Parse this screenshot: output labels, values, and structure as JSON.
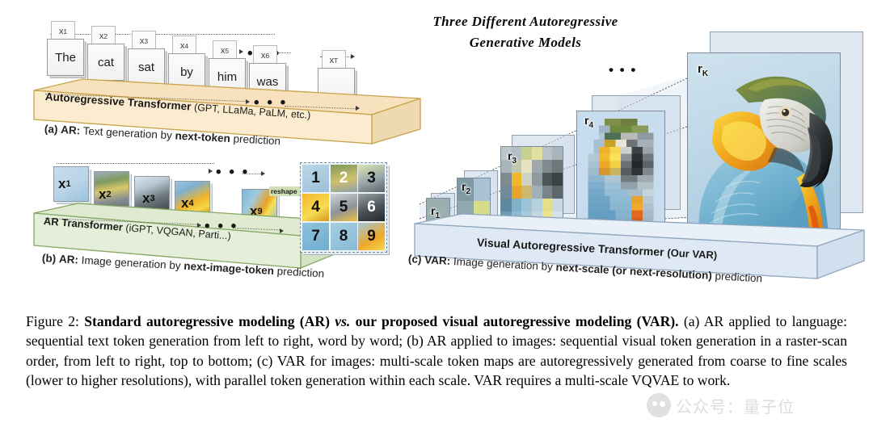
{
  "figure": {
    "heading_line1": "Three  Different  Autoregressive",
    "heading_line2": "Generative  Models",
    "caption_label": "Figure 2:",
    "caption_bold": "Standard autoregressive modeling (AR)",
    "caption_italic": "vs.",
    "caption_bold2": "our proposed visual autoregressive modeling (VAR).",
    "caption_rest": "(a) AR applied to language: sequential text token generation from left to right, word by word; (b) AR applied to images: sequential visual token generation in a raster-scan order, from left to right, top to bottom; (c) VAR for images: multi-scale token maps are autoregressively generated from coarse to fine scales (lower to higher resolutions), with parallel token generation within each scale. VAR requires a multi-scale VQVAE to work."
  },
  "watermark": {
    "text": "公众号：量子位"
  },
  "panel_a": {
    "platform_label_bold": "Autoregressive Transformer",
    "platform_label_rest": "(GPT, LLaMa, PaLM, etc.)",
    "tokens": [
      {
        "tag": "x",
        "sub": "1",
        "word": "The"
      },
      {
        "tag": "x",
        "sub": "2",
        "word": "cat"
      },
      {
        "tag": "x",
        "sub": "3",
        "word": "sat"
      },
      {
        "tag": "x",
        "sub": "4",
        "word": "by"
      },
      {
        "tag": "x",
        "sub": "5",
        "word": "him"
      },
      {
        "tag": "x",
        "sub": "6",
        "word": "was"
      },
      {
        "tag": "x",
        "sub": "T",
        "word": "."
      }
    ],
    "ellipsis": "• • •",
    "caption_prefix": "(a)",
    "caption_kind": "AR:",
    "caption_text_1": "Text generation by",
    "caption_bold": "next-token",
    "caption_text_2": "prediction",
    "colors": {
      "fill": "#fbeccf",
      "edge": "#c9a24a",
      "top": "#f7e2bd",
      "side": "#eed9b0"
    }
  },
  "panel_b": {
    "platform_label_bold": "AR Transformer",
    "platform_label_rest": "(iGPT, VQGAN, Parti...)",
    "tokens": [
      {
        "tag": "x",
        "sub": "1"
      },
      {
        "tag": "x",
        "sub": "2"
      },
      {
        "tag": "x",
        "sub": "3"
      },
      {
        "tag": "x",
        "sub": "4"
      },
      {
        "tag": "x",
        "sub": "9"
      }
    ],
    "reshape_label": "reshape",
    "grid_numbers": [
      "1",
      "2",
      "3",
      "4",
      "5",
      "6",
      "7",
      "8",
      "9"
    ],
    "ellipsis": "• • •",
    "caption_prefix": "(b)",
    "caption_kind": "AR:",
    "caption_text_1": "Image generation by",
    "caption_bold": "next-image-token",
    "caption_text_2": "prediction",
    "colors": {
      "fill": "#e4eed8",
      "edge": "#86a765",
      "top": "#dfead1",
      "side": "#d3e2c1"
    }
  },
  "panel_c": {
    "platform_label_bold": "Visual Autoregressive Transformer",
    "platform_label_rest": "(Our VAR)",
    "scales": [
      {
        "label": "r",
        "sub": "1"
      },
      {
        "label": "r",
        "sub": "2"
      },
      {
        "label": "r",
        "sub": "3"
      },
      {
        "label": "r",
        "sub": "4"
      },
      {
        "label": "r",
        "sub": "K"
      }
    ],
    "ellipsis": "• • •",
    "caption_prefix": "(c)",
    "caption_kind": "VAR:",
    "caption_text_1": "Image generation by",
    "caption_bold": "next-scale (or next-resolution)",
    "caption_text_2": "prediction",
    "colors": {
      "fill": "#dfe9f5",
      "edge": "#8fa6bd",
      "top": "#e9f0f8",
      "side": "#d2dfee"
    }
  }
}
